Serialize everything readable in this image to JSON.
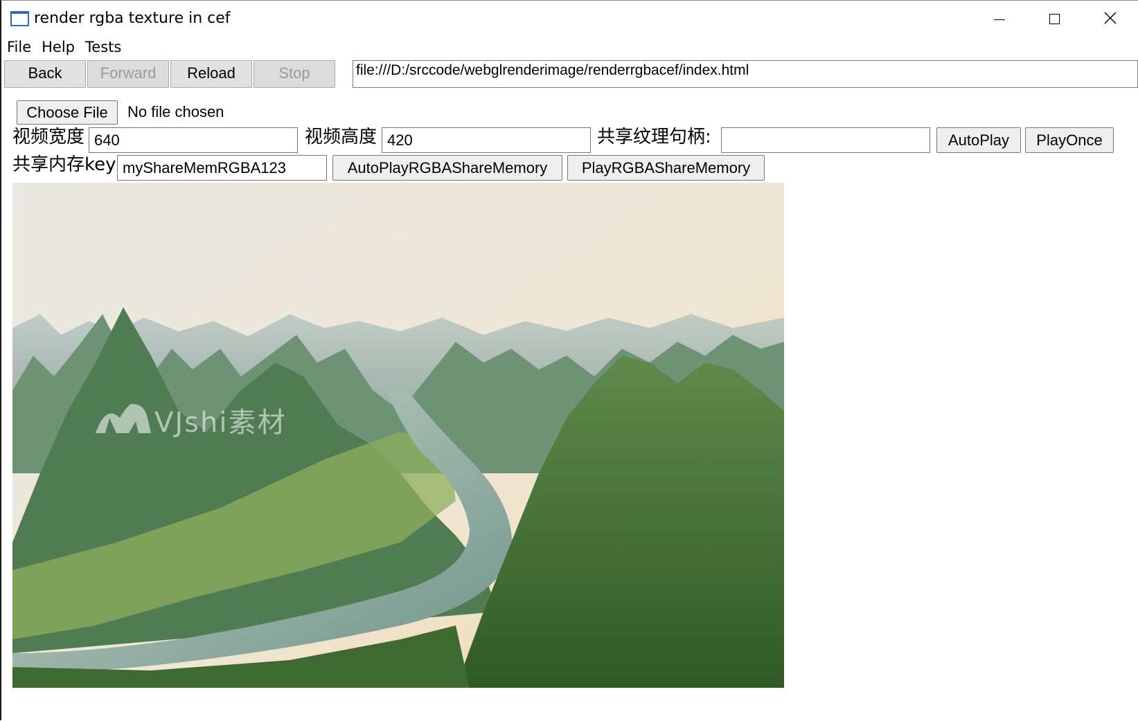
{
  "window": {
    "title": "render rgba texture in cef"
  },
  "menu": {
    "items": [
      "File",
      "Help",
      "Tests"
    ]
  },
  "nav": {
    "back_label": "Back",
    "forward_label": "Forward",
    "reload_label": "Reload",
    "stop_label": "Stop",
    "url": "file:///D:/srccode/webglrenderimage/renderrgbacef/index.html"
  },
  "page": {
    "choose_file_label": "Choose File",
    "file_status": "No file chosen",
    "video_width_label": "视频宽度",
    "video_width_value": "640",
    "video_height_label": "视频高度",
    "video_height_value": "420",
    "shared_texture_label": "共享纹理句柄:",
    "shared_texture_value": "",
    "autoplay_label": "AutoPlay",
    "playonce_label": "PlayOnce",
    "share_mem_label": "共享内存key",
    "share_mem_value": "myShareMemRGBA123",
    "autoplay_rgba_label": "AutoPlayRGBAShareMemory",
    "play_rgba_label": "PlayRGBAShareMemory",
    "watermark": "VJshi素材"
  },
  "colors": {
    "accent": "#2b6cc4",
    "button_bg": "#e1e1e1",
    "disabled_text": "#9a9a9a"
  }
}
